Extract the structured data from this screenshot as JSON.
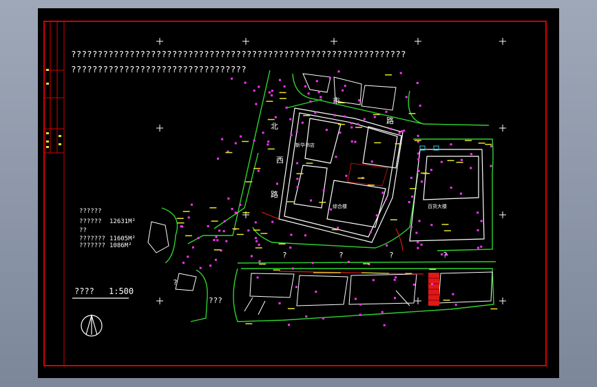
{
  "drawing": {
    "notes": [
      "???????????????????????????????????????????????????????????????",
      "?????????????????????????????????"
    ],
    "legend": {
      "title": "??????",
      "rows": [
        {
          "label": "??????",
          "value": "12631M²"
        },
        {
          "label": "??",
          "value": ""
        },
        {
          "label": "???????",
          "value": "11605M²"
        },
        {
          "label": "???????",
          "value": "1086M²"
        }
      ]
    },
    "scale_title": "????",
    "scale_value": "1:500",
    "building_labels": {
      "main": "新华书店",
      "secondary": "综合楼",
      "right": "百货大楼"
    },
    "road_labels": [
      "市",
      "西",
      "北",
      "路",
      "路",
      "?",
      "?",
      "?",
      "?",
      "?",
      "???"
    ],
    "north_symbol": "north-arrow"
  },
  "colors": {
    "background": "#000000",
    "frame": "#d40000",
    "road_line": "#2fd42f",
    "building": "#ffffff",
    "marker": "#ff33ff",
    "dimension": "#e6e62a",
    "accent_red": "#e01818",
    "cyan": "#34c6e0"
  }
}
